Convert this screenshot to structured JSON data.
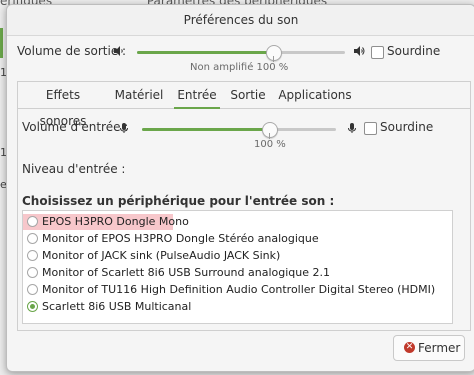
{
  "background_window": {
    "left_fragment": "érifiques",
    "title_fragment": "Paramètres des périphériques",
    "side_letters": [
      "1",
      "1"
    ],
    "side_text": "s",
    "side_e": "e"
  },
  "dialog": {
    "title": "Préférences du son",
    "output": {
      "label": "Volume de sortie :",
      "value_percent": 100,
      "mark_label": "Non amplifié 100 %",
      "mute_label": "Sourdine"
    },
    "tabs": [
      {
        "label": "Effets sonores",
        "active": false
      },
      {
        "label": "Matériel",
        "active": false
      },
      {
        "label": "Entrée",
        "active": true
      },
      {
        "label": "Sortie",
        "active": false
      },
      {
        "label": "Applications",
        "active": false
      }
    ],
    "input": {
      "label": "Volume d'entrée :",
      "value_percent": 100,
      "mark_label": "100 %",
      "mute_label": "Sourdine",
      "level_label": "Niveau d'entrée :"
    },
    "device_heading": "Choisissez un périphérique pour l'entrée son :",
    "devices": [
      {
        "label": "EPOS H3PRO Dongle Mono",
        "selected": false,
        "highlighted": true
      },
      {
        "label": "Monitor of EPOS H3PRO Dongle Stéréo analogique",
        "selected": false
      },
      {
        "label": "Monitor of JACK sink (PulseAudio JACK Sink)",
        "selected": false
      },
      {
        "label": "Monitor of Scarlett 8i6 USB Surround analogique 2.1",
        "selected": false
      },
      {
        "label": "Monitor of TU116 High Definition Audio Controller Digital Stereo (HDMI)",
        "selected": false
      },
      {
        "label": "Scarlett 8i6 USB Multicanal",
        "selected": true
      }
    ],
    "close_button": "Fermer",
    "colors": {
      "accent": "#6aa64a",
      "highlight": "#f7c7cb",
      "close_icon": "#c0392b"
    }
  }
}
